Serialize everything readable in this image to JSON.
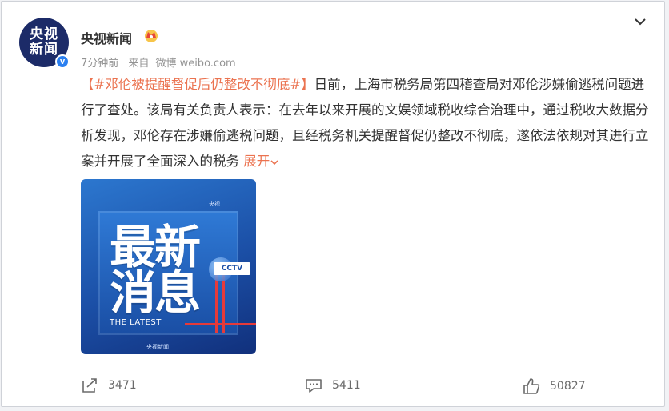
{
  "account": {
    "avatar_line1": "央视",
    "avatar_line2": "新闻",
    "verified_mark": "v",
    "name": "央视新闻"
  },
  "meta": {
    "time": "7分钟前",
    "source_prefix": "来自",
    "source": "微博 weibo.com"
  },
  "post": {
    "bracket_open": "【",
    "hashtag": "#邓伦被提醒督促后仍整改不彻底#",
    "bracket_close": "】",
    "body": "日前，上海市税务局第四稽查局对邓伦涉嫌偷逃税问题进行了查处。该局有关负责人表示：在去年以来开展的文娱领域税收综合治理中，通过税收大数据分析发现，邓伦存在涉嫌偷逃税问题，且经税务机关提醒督促仍整改不彻底，遂依法依规对其进行立案并开展了全面深入的税务",
    "expand": "展开"
  },
  "image": {
    "title_line1": "最新",
    "title_line2": "消息",
    "subtitle": "THE LATEST",
    "logo": "CCTV",
    "top_mark": "央视",
    "bottom_mark": "央视新闻"
  },
  "actions": {
    "repost_count": "3471",
    "comment_count": "5411",
    "like_count": "50827"
  },
  "colors": {
    "accent": "#eb7350",
    "verified": "#2a7ff0",
    "avatar_bg": "#1c2b68"
  }
}
